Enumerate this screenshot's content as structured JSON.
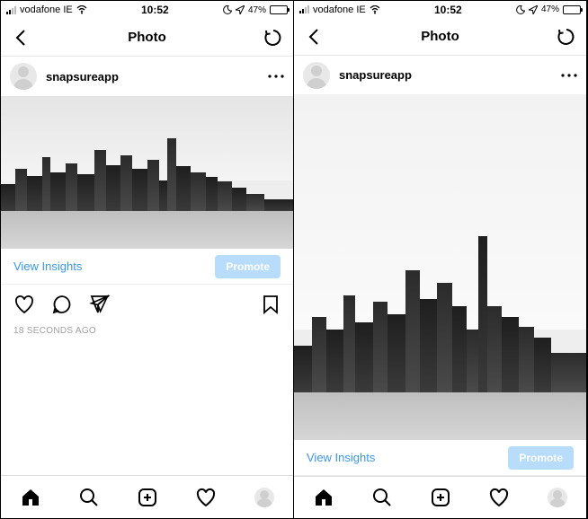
{
  "status": {
    "carrier": "vodafone IE",
    "time": "10:52",
    "battery_pct": "47%"
  },
  "nav": {
    "title": "Photo"
  },
  "user": {
    "name": "snapsureapp"
  },
  "insights": {
    "view_label": "View Insights",
    "promote_label": "Promote"
  },
  "timestamp": "18 SECONDS AGO",
  "icons": {
    "back": "back-chevron",
    "refresh": "refresh-icon",
    "more": "more-icon",
    "like": "heart-icon",
    "comment": "comment-icon",
    "share": "share-icon",
    "bookmark": "bookmark-icon",
    "home": "home-icon",
    "search": "search-icon",
    "new": "new-post-icon",
    "profile": "profile-icon"
  }
}
